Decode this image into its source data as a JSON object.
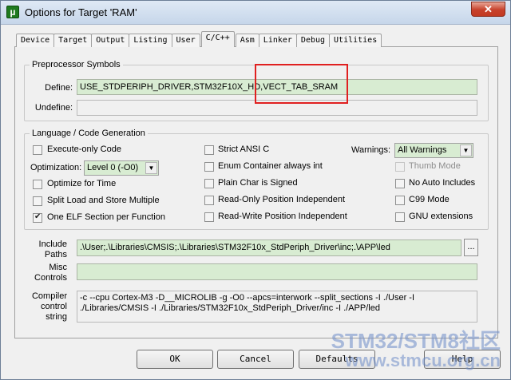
{
  "window": {
    "icon": "µ",
    "title": "Options for Target 'RAM'",
    "close_glyph": "✕"
  },
  "tabs": [
    "Device",
    "Target",
    "Output",
    "Listing",
    "User",
    "C/C++",
    "Asm",
    "Linker",
    "Debug",
    "Utilities"
  ],
  "active_tab": "C/C++",
  "preprocessor": {
    "legend": "Preprocessor Symbols",
    "define_label": "Define:",
    "define_value": "USE_STDPERIPH_DRIVER,STM32F10X_HD,VECT_TAB_SRAM",
    "undefine_label": "Undefine:",
    "undefine_value": ""
  },
  "language": {
    "legend": "Language / Code Generation",
    "execute_only": {
      "label": "Execute-only Code",
      "checked": false
    },
    "optimization_label": "Optimization:",
    "optimization_value": "Level 0 (-O0)",
    "optimize_time": {
      "label": "Optimize for Time",
      "checked": false
    },
    "split_load": {
      "label": "Split Load and Store Multiple",
      "checked": false
    },
    "one_elf": {
      "label": "One ELF Section per Function",
      "checked": true
    },
    "strict_ansi": {
      "label": "Strict ANSI C",
      "checked": false
    },
    "enum_container": {
      "label": "Enum Container always int",
      "checked": false
    },
    "plain_char": {
      "label": "Plain Char is Signed",
      "checked": false
    },
    "ro_pos": {
      "label": "Read-Only Position Independent",
      "checked": false
    },
    "rw_pos": {
      "label": "Read-Write Position Independent",
      "checked": false
    },
    "warnings_label": "Warnings:",
    "warnings_value": "All Warnings",
    "thumb_mode": {
      "label": "Thumb Mode",
      "checked": false,
      "disabled": true
    },
    "no_auto_includes": {
      "label": "No Auto Includes",
      "checked": false
    },
    "c99_mode": {
      "label": "C99 Mode",
      "checked": false
    },
    "gnu_extensions": {
      "label": "GNU extensions",
      "checked": false
    }
  },
  "include": {
    "label_line1": "Include",
    "label_line2": "Paths",
    "value": ".\\User;.\\Libraries\\CMSIS;.\\Libraries\\STM32F10x_StdPeriph_Driver\\inc;.\\APP\\led",
    "browse_label": "..."
  },
  "misc": {
    "label_line1": "Misc",
    "label_line2": "Controls",
    "value": ""
  },
  "compiler": {
    "label_line1": "Compiler",
    "label_line2": "control",
    "label_line3": "string",
    "value": "-c --cpu Cortex-M3 -D__MICROLIB -g -O0 --apcs=interwork --split_sections -I ./User -I ./Libraries/CMSIS -I ./Libraries/STM32F10x_StdPeriph_Driver/inc -I ./APP/led"
  },
  "buttons": {
    "ok": "OK",
    "cancel": "Cancel",
    "defaults": "Defaults",
    "help": "Help"
  },
  "watermark": {
    "line1": "STM32/STM8社区",
    "line2": "www.stmcu.org.cn"
  },
  "colors": {
    "field_green": "#d8ecd2",
    "highlight_red": "#e02020"
  }
}
